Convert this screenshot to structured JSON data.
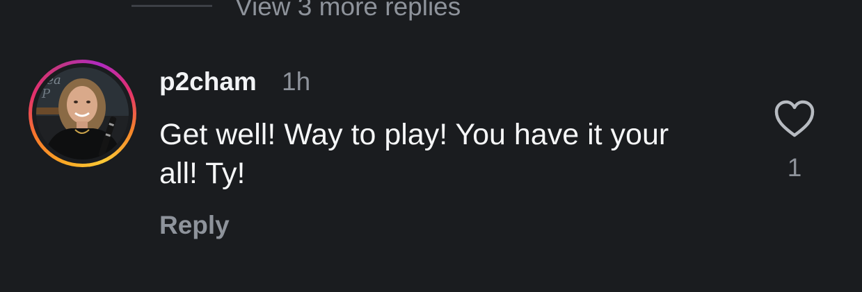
{
  "thread": {
    "view_more_replies_label": "View 3 more replies"
  },
  "comment": {
    "username": "p2cham",
    "timestamp": "1h",
    "text": "Get well! Way to play! You have it your all! Ty!",
    "reply_label": "Reply",
    "like_count": "1",
    "avatar_ring_colors": [
      "#f9a825",
      "#e4306c",
      "#c13584"
    ]
  },
  "icons": {
    "like": "heart-outline-icon"
  }
}
